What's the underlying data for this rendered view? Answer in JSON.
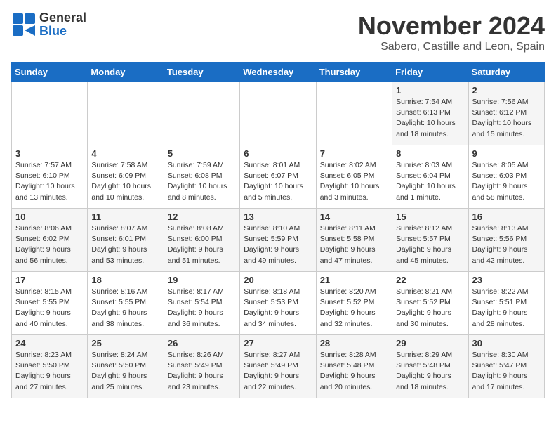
{
  "header": {
    "logo_general": "General",
    "logo_blue": "Blue",
    "month": "November 2024",
    "location": "Sabero, Castille and Leon, Spain"
  },
  "weekdays": [
    "Sunday",
    "Monday",
    "Tuesday",
    "Wednesday",
    "Thursday",
    "Friday",
    "Saturday"
  ],
  "weeks": [
    [
      {
        "day": "",
        "info": ""
      },
      {
        "day": "",
        "info": ""
      },
      {
        "day": "",
        "info": ""
      },
      {
        "day": "",
        "info": ""
      },
      {
        "day": "",
        "info": ""
      },
      {
        "day": "1",
        "info": "Sunrise: 7:54 AM\nSunset: 6:13 PM\nDaylight: 10 hours\nand 18 minutes."
      },
      {
        "day": "2",
        "info": "Sunrise: 7:56 AM\nSunset: 6:12 PM\nDaylight: 10 hours\nand 15 minutes."
      }
    ],
    [
      {
        "day": "3",
        "info": "Sunrise: 7:57 AM\nSunset: 6:10 PM\nDaylight: 10 hours\nand 13 minutes."
      },
      {
        "day": "4",
        "info": "Sunrise: 7:58 AM\nSunset: 6:09 PM\nDaylight: 10 hours\nand 10 minutes."
      },
      {
        "day": "5",
        "info": "Sunrise: 7:59 AM\nSunset: 6:08 PM\nDaylight: 10 hours\nand 8 minutes."
      },
      {
        "day": "6",
        "info": "Sunrise: 8:01 AM\nSunset: 6:07 PM\nDaylight: 10 hours\nand 5 minutes."
      },
      {
        "day": "7",
        "info": "Sunrise: 8:02 AM\nSunset: 6:05 PM\nDaylight: 10 hours\nand 3 minutes."
      },
      {
        "day": "8",
        "info": "Sunrise: 8:03 AM\nSunset: 6:04 PM\nDaylight: 10 hours\nand 1 minute."
      },
      {
        "day": "9",
        "info": "Sunrise: 8:05 AM\nSunset: 6:03 PM\nDaylight: 9 hours\nand 58 minutes."
      }
    ],
    [
      {
        "day": "10",
        "info": "Sunrise: 8:06 AM\nSunset: 6:02 PM\nDaylight: 9 hours\nand 56 minutes."
      },
      {
        "day": "11",
        "info": "Sunrise: 8:07 AM\nSunset: 6:01 PM\nDaylight: 9 hours\nand 53 minutes."
      },
      {
        "day": "12",
        "info": "Sunrise: 8:08 AM\nSunset: 6:00 PM\nDaylight: 9 hours\nand 51 minutes."
      },
      {
        "day": "13",
        "info": "Sunrise: 8:10 AM\nSunset: 5:59 PM\nDaylight: 9 hours\nand 49 minutes."
      },
      {
        "day": "14",
        "info": "Sunrise: 8:11 AM\nSunset: 5:58 PM\nDaylight: 9 hours\nand 47 minutes."
      },
      {
        "day": "15",
        "info": "Sunrise: 8:12 AM\nSunset: 5:57 PM\nDaylight: 9 hours\nand 45 minutes."
      },
      {
        "day": "16",
        "info": "Sunrise: 8:13 AM\nSunset: 5:56 PM\nDaylight: 9 hours\nand 42 minutes."
      }
    ],
    [
      {
        "day": "17",
        "info": "Sunrise: 8:15 AM\nSunset: 5:55 PM\nDaylight: 9 hours\nand 40 minutes."
      },
      {
        "day": "18",
        "info": "Sunrise: 8:16 AM\nSunset: 5:55 PM\nDaylight: 9 hours\nand 38 minutes."
      },
      {
        "day": "19",
        "info": "Sunrise: 8:17 AM\nSunset: 5:54 PM\nDaylight: 9 hours\nand 36 minutes."
      },
      {
        "day": "20",
        "info": "Sunrise: 8:18 AM\nSunset: 5:53 PM\nDaylight: 9 hours\nand 34 minutes."
      },
      {
        "day": "21",
        "info": "Sunrise: 8:20 AM\nSunset: 5:52 PM\nDaylight: 9 hours\nand 32 minutes."
      },
      {
        "day": "22",
        "info": "Sunrise: 8:21 AM\nSunset: 5:52 PM\nDaylight: 9 hours\nand 30 minutes."
      },
      {
        "day": "23",
        "info": "Sunrise: 8:22 AM\nSunset: 5:51 PM\nDaylight: 9 hours\nand 28 minutes."
      }
    ],
    [
      {
        "day": "24",
        "info": "Sunrise: 8:23 AM\nSunset: 5:50 PM\nDaylight: 9 hours\nand 27 minutes."
      },
      {
        "day": "25",
        "info": "Sunrise: 8:24 AM\nSunset: 5:50 PM\nDaylight: 9 hours\nand 25 minutes."
      },
      {
        "day": "26",
        "info": "Sunrise: 8:26 AM\nSunset: 5:49 PM\nDaylight: 9 hours\nand 23 minutes."
      },
      {
        "day": "27",
        "info": "Sunrise: 8:27 AM\nSunset: 5:49 PM\nDaylight: 9 hours\nand 22 minutes."
      },
      {
        "day": "28",
        "info": "Sunrise: 8:28 AM\nSunset: 5:48 PM\nDaylight: 9 hours\nand 20 minutes."
      },
      {
        "day": "29",
        "info": "Sunrise: 8:29 AM\nSunset: 5:48 PM\nDaylight: 9 hours\nand 18 minutes."
      },
      {
        "day": "30",
        "info": "Sunrise: 8:30 AM\nSunset: 5:47 PM\nDaylight: 9 hours\nand 17 minutes."
      }
    ]
  ]
}
